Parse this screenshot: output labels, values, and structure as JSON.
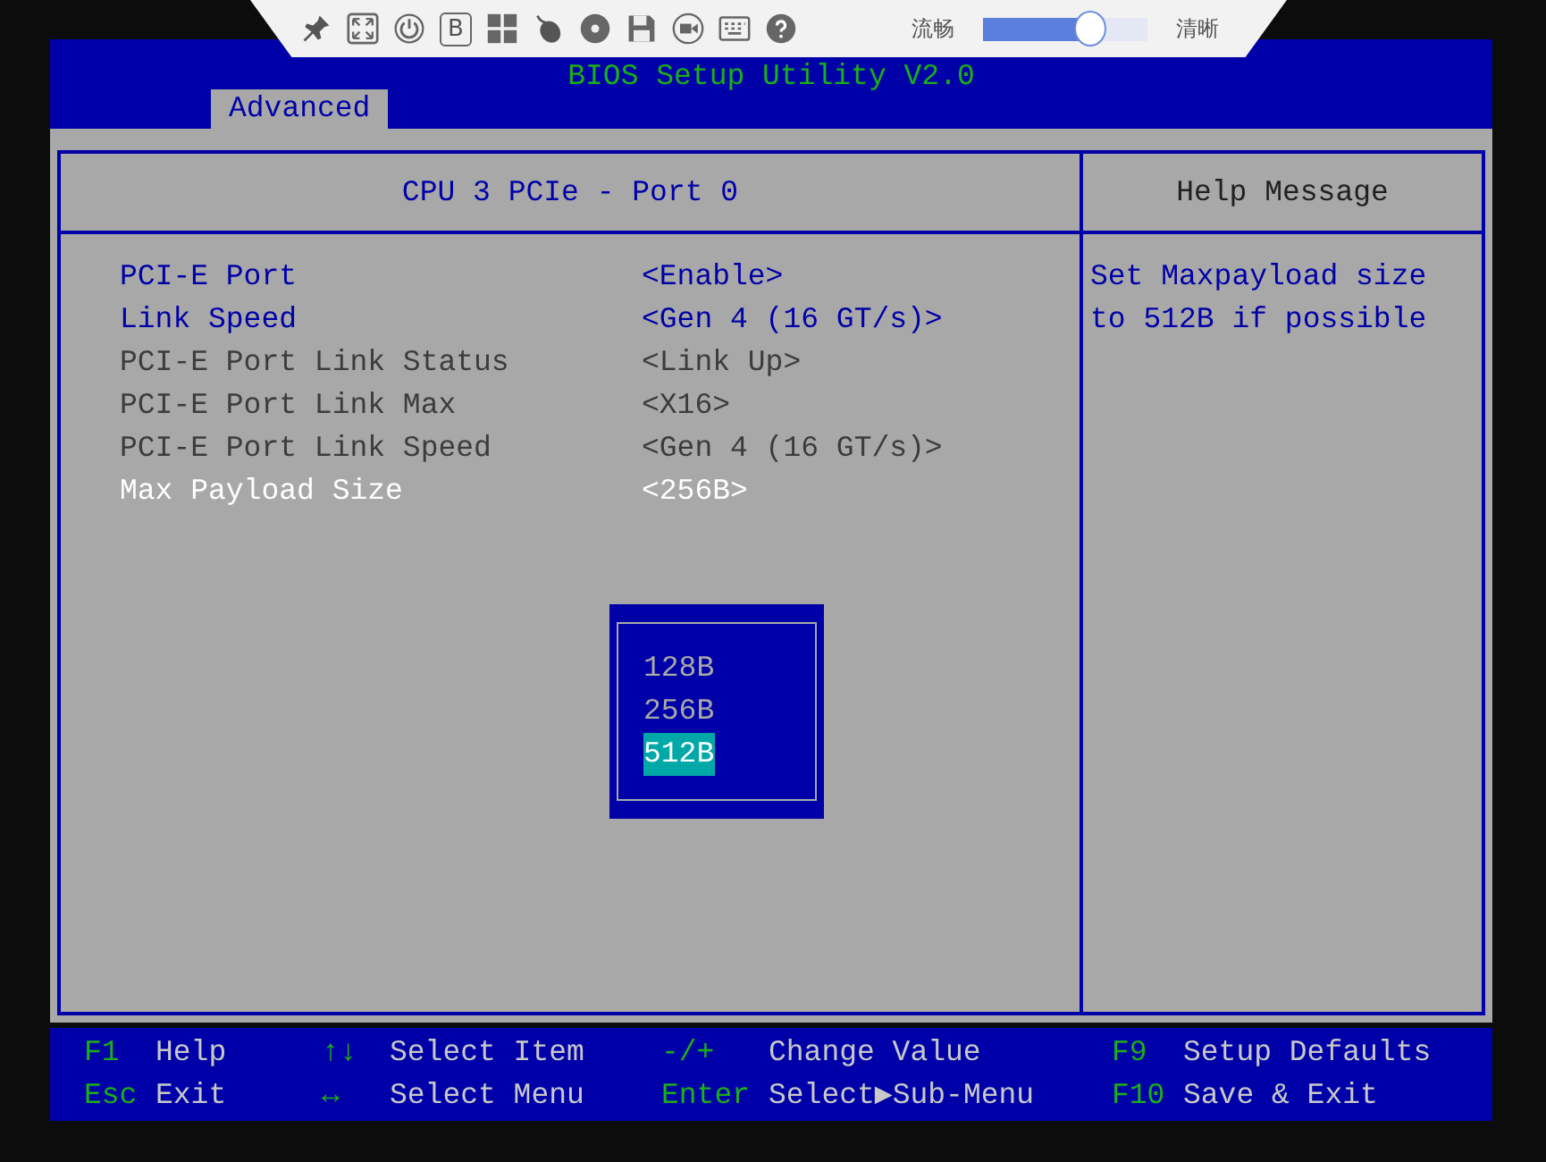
{
  "toolbar": {
    "badge": "B",
    "slider": {
      "left_label": "流畅",
      "right_label": "清晰",
      "level": 0.65
    }
  },
  "title": "BIOS Setup Utility V2.0",
  "tabs": [
    {
      "label": "Advanced",
      "selected": true
    }
  ],
  "panel_title": "CPU 3 PCIe - Port 0",
  "settings": [
    {
      "label": "PCI-E Port",
      "value": "<Enable>",
      "kind": "editable",
      "selected": false
    },
    {
      "label": "Link Speed",
      "value": "<Gen 4 (16 GT/s)>",
      "kind": "editable",
      "selected": false
    },
    {
      "label": "PCI-E Port Link Status",
      "value": "<Link Up>",
      "kind": "readonly",
      "selected": false
    },
    {
      "label": "PCI-E Port Link Max",
      "value": "<X16>",
      "kind": "readonly",
      "selected": false
    },
    {
      "label": "PCI-E Port Link Speed",
      "value": "<Gen 4 (16 GT/s)>",
      "kind": "readonly",
      "selected": false
    },
    {
      "label": "Max Payload Size",
      "value": "<256B>",
      "kind": "editable",
      "selected": true
    }
  ],
  "help": {
    "title": "Help Message",
    "text": "Set Maxpayload size to 512B if possible"
  },
  "popup": {
    "options": [
      {
        "label": "128B",
        "selected": false
      },
      {
        "label": "256B",
        "selected": false
      },
      {
        "label": "512B",
        "selected": true
      }
    ]
  },
  "legend": [
    {
      "key": "F1",
      "action": "Help"
    },
    {
      "key": "↑↓",
      "action": "Select Item"
    },
    {
      "key": "-/+",
      "action": "Change Value"
    },
    {
      "key": "F9",
      "action": "Setup Defaults"
    },
    {
      "key": "Esc",
      "action": "Exit"
    },
    {
      "key": "↔",
      "action": "Select Menu"
    },
    {
      "key": "Enter",
      "action": "Select▶Sub-Menu"
    },
    {
      "key": "F10",
      "action": "Save & Exit"
    }
  ]
}
